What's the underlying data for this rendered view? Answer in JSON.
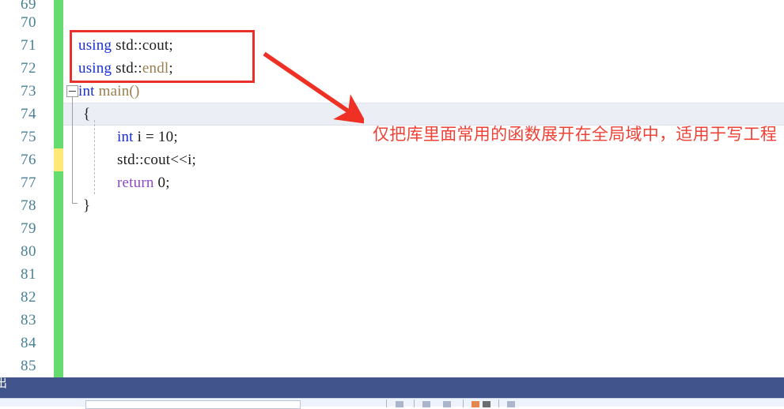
{
  "editor": {
    "line_numbers": [
      "69",
      "70",
      "71",
      "72",
      "73",
      "74",
      "75",
      "76",
      "77",
      "78",
      "79",
      "80",
      "81",
      "82",
      "83",
      "84",
      "85"
    ],
    "code_lines": [
      {
        "number": "71",
        "text": "using std::cout;"
      },
      {
        "number": "72",
        "text": "using std::endl;"
      },
      {
        "number": "73",
        "text": "int main()"
      },
      {
        "number": "74",
        "text": "{"
      },
      {
        "number": "75",
        "text": "int i = 10;"
      },
      {
        "number": "76",
        "text": "std::cout<<i;"
      },
      {
        "number": "77",
        "text": "return 0;"
      },
      {
        "number": "78",
        "text": "}"
      }
    ],
    "tokens": {
      "using": "using",
      "std_cout": "std::cout;",
      "std_endl_std": "std::",
      "std_endl_endl": "endl",
      "std_endl_semi": ";",
      "int": "int",
      "main": " main()",
      "open_brace": "{",
      "int2": "int",
      "decl_rest": " i = 10;",
      "cout_stmt": "std::cout<<i;",
      "return": "return",
      "return_rest": " 0;",
      "close_brace": "}"
    },
    "current_line": "74",
    "fold_marker": "collapse-minus",
    "change_marker_color": "#64dd6e",
    "modified_marker_color": "#ffe877",
    "linenumber_color": "#4a8196"
  },
  "annotations": {
    "box_label": "using-declarations-highlight",
    "box_color": "#e8312a",
    "arrow_color": "#ee3124",
    "note_text": "仅把库里面常用的函数展开在全局域中，适用于写工程",
    "note_color": "#ef4136"
  },
  "statusbar": {
    "label": "出",
    "background": "#41558c"
  },
  "bottom_panel": {
    "background": "#eef2fb"
  }
}
